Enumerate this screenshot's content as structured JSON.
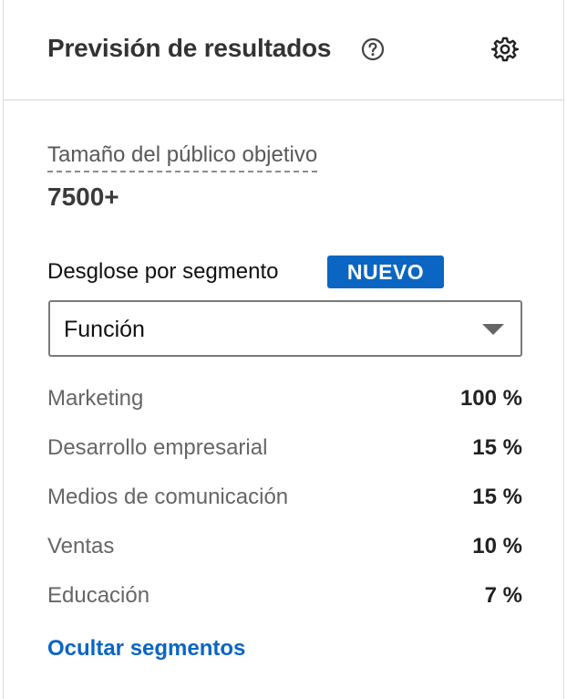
{
  "header": {
    "title": "Previsión de resultados",
    "help_icon": "question-circle-icon",
    "settings_icon": "gear-icon"
  },
  "audience": {
    "label": "Tamaño del público objetivo",
    "value": "7500+"
  },
  "segments": {
    "heading": "Desglose por segmento",
    "badge": "NUEVO",
    "select": {
      "value": "Función"
    },
    "items": [
      {
        "name": "Marketing",
        "percent": "100 %"
      },
      {
        "name": "Desarrollo empresarial",
        "percent": "15 %"
      },
      {
        "name": "Medios de comunicación",
        "percent": "15 %"
      },
      {
        "name": "Ventas",
        "percent": "10 %"
      },
      {
        "name": "Educación",
        "percent": "7 %"
      }
    ],
    "hide_link": "Ocultar segmentos"
  },
  "colors": {
    "accent": "#0a66c2",
    "badge_text": "#ffffff"
  }
}
